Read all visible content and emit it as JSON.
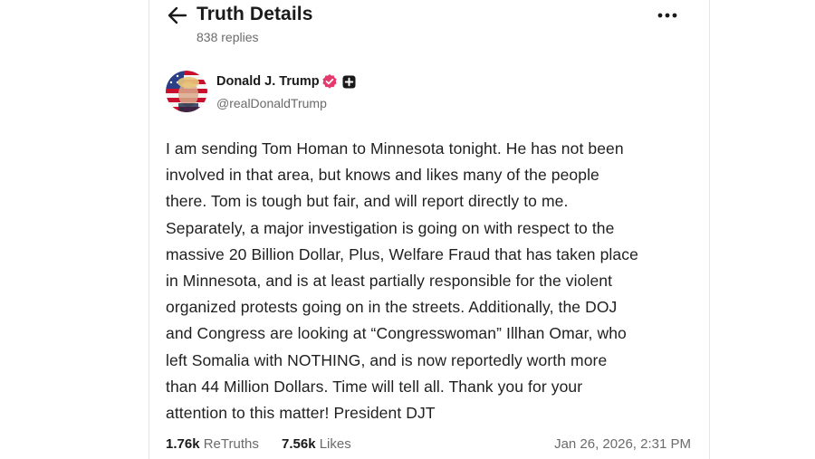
{
  "header": {
    "title": "Truth Details",
    "replies": "838 replies"
  },
  "post": {
    "author_name": "Donald J. Trump",
    "handle": "@realDonaldTrump",
    "body": "I am sending Tom Homan to Minnesota tonight. He has not been\ninvolved in that area, but knows and likes many of the people\nthere. Tom is tough but fair, and will report directly to me.\nSeparately, a major investigation is going on with respect to the\nmassive 20 Billion Dollar, Plus, Welfare Fraud that has taken place\nin Minnesota, and is at least partially responsible for the violent\norganized protests going on in the streets. Additionally, the DOJ\nand Congress are looking at “Congresswoman” Illhan Omar, who\nleft Somalia with NOTHING, and is now reportedly worth more\nthan 44 Million Dollars. Time will tell all. Thank you for your\nattention to this matter! President DJT",
    "retruths_count": "1.76k",
    "retruths_label": "ReTruths",
    "likes_count": "7.56k",
    "likes_label": "Likes",
    "timestamp": "Jan 26, 2026, 2:31 PM"
  },
  "icons": {
    "back": "arrow-left-icon",
    "more": "more-horizontal-icon",
    "verified": "verified-badge-icon",
    "plus": "plus-badge-icon"
  },
  "colors": {
    "verified_badge": "#e5396c",
    "text_primary": "#1a1a1a",
    "text_secondary": "#6b6b6b"
  }
}
